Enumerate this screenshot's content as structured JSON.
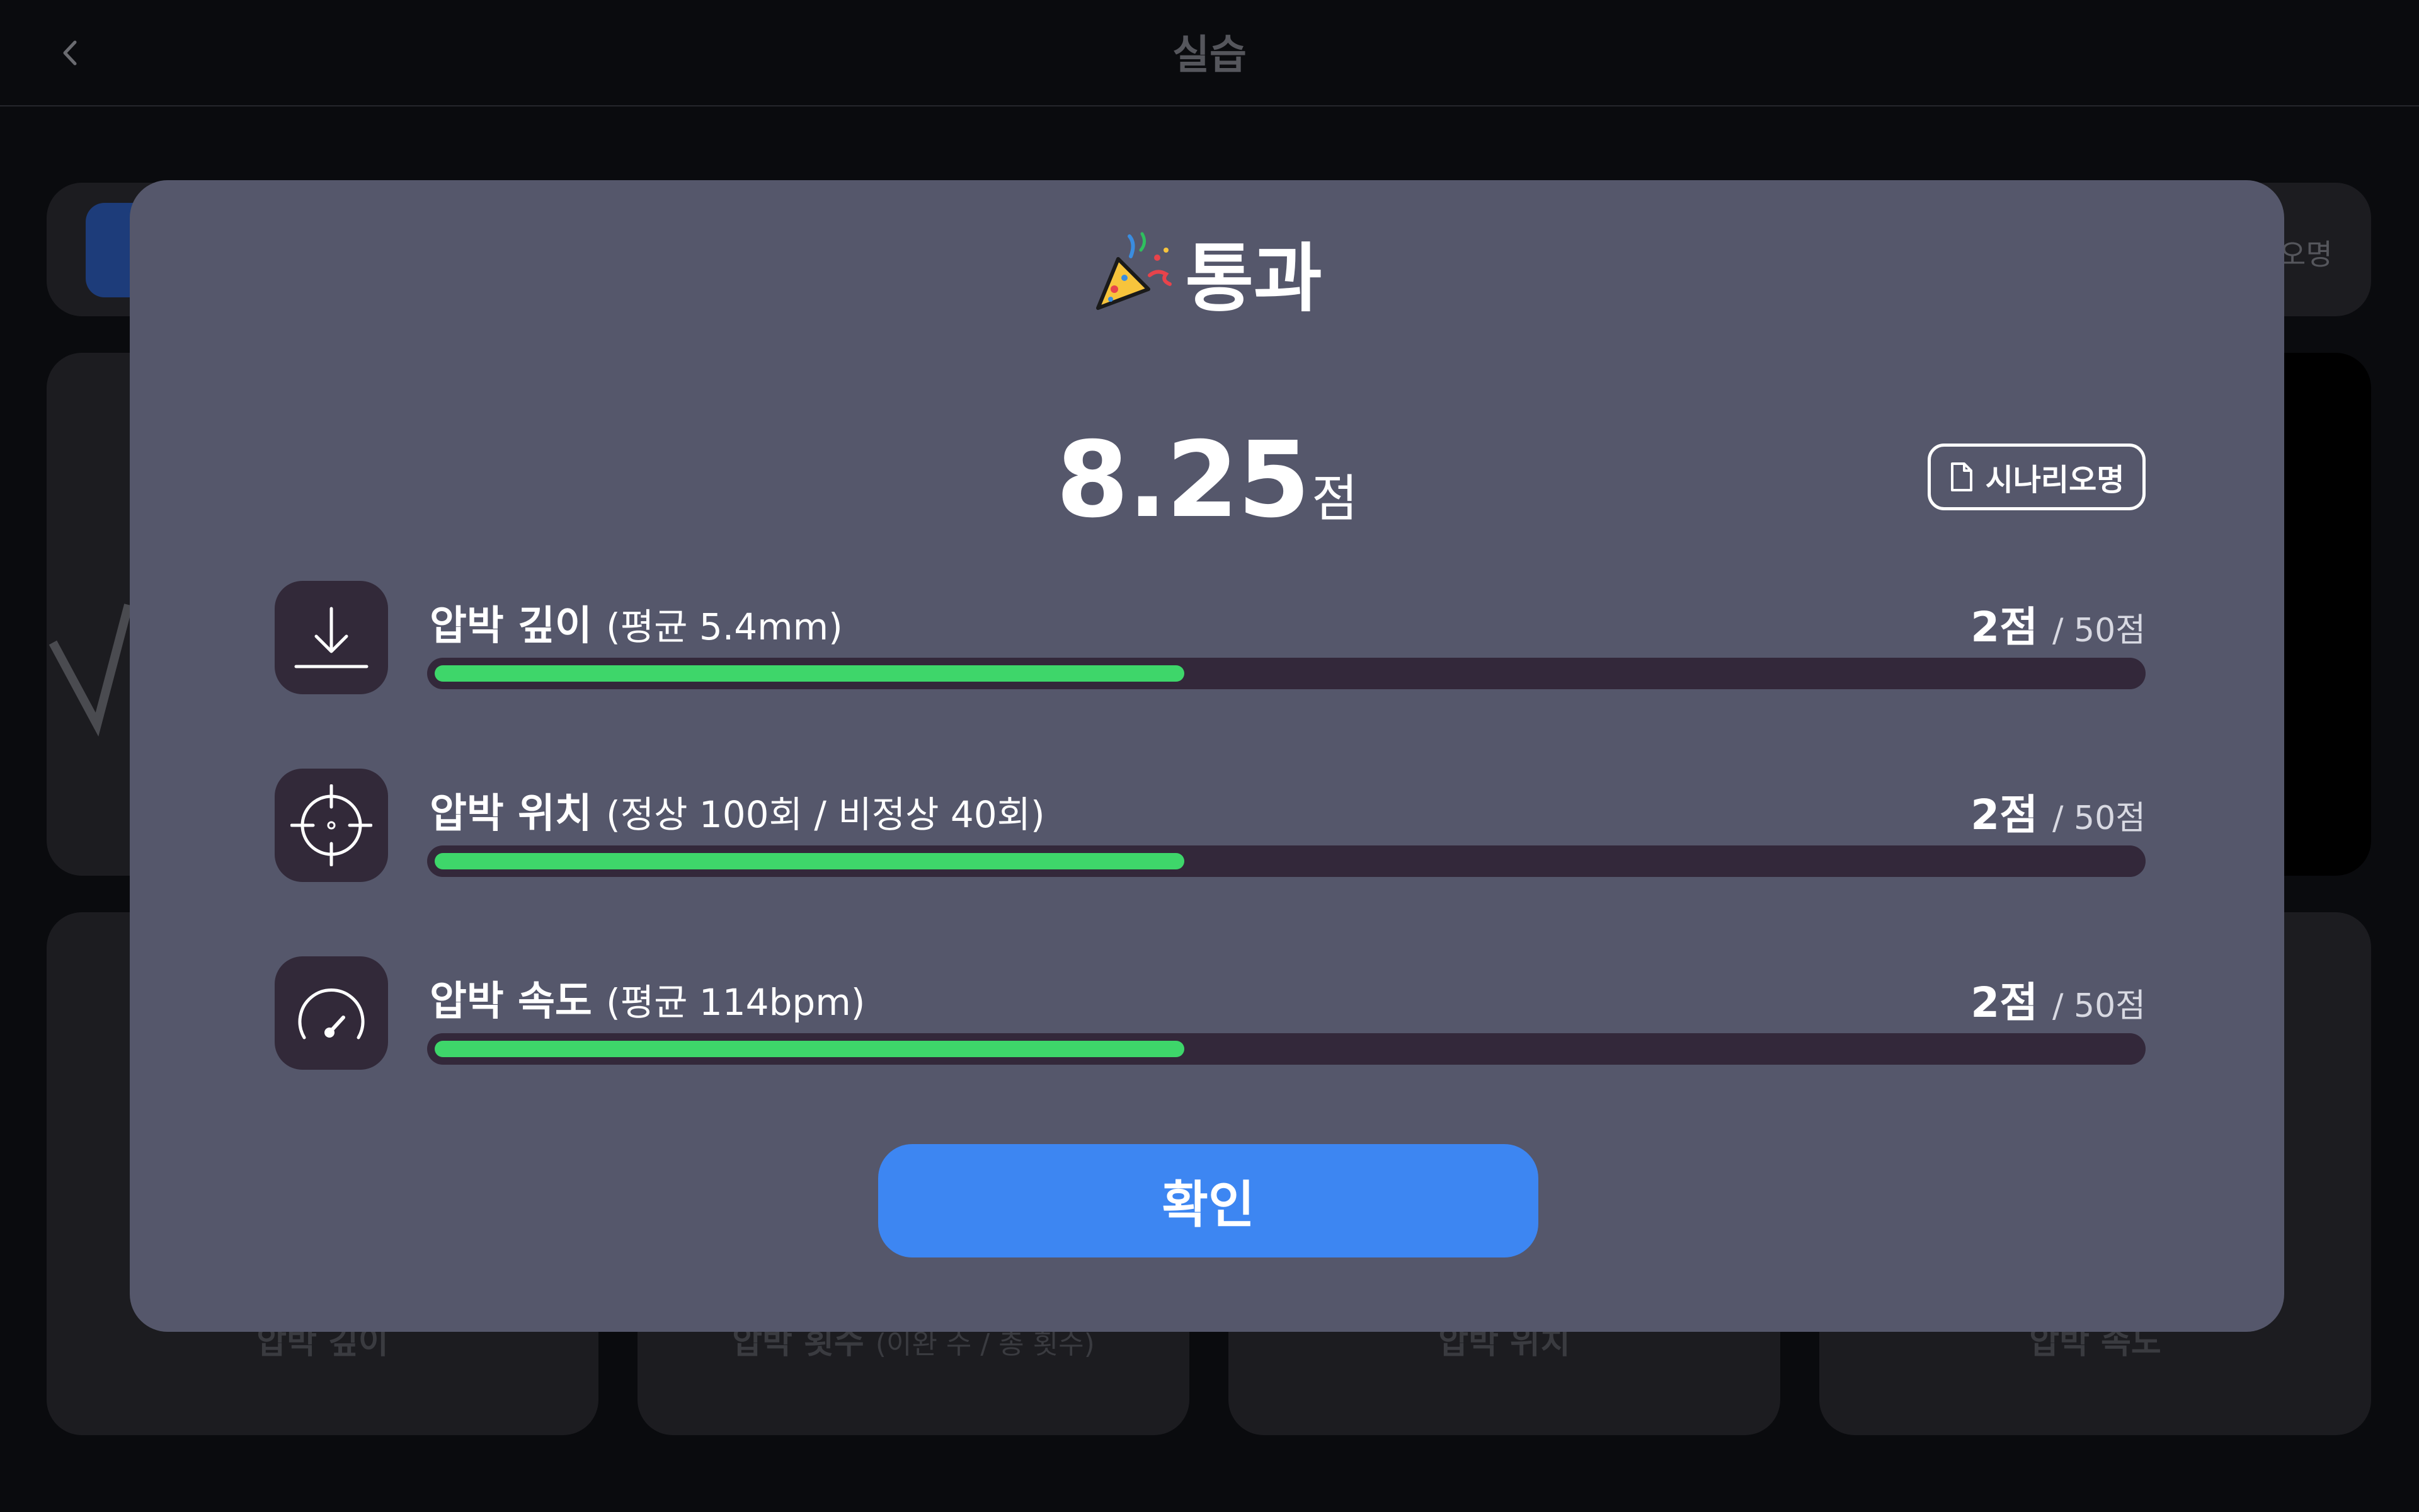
{
  "header": {
    "title": "실습",
    "back_icon": "chevron-left-icon"
  },
  "background": {
    "tab_right_label": "오명",
    "tiles": [
      {
        "label": "압박 깊이",
        "sub": ""
      },
      {
        "label": "압박 횟수",
        "sub": "(이완 수 / 총 횟수)"
      },
      {
        "label": "압박 위치",
        "sub": ""
      },
      {
        "label": "압박 속도",
        "sub": ""
      }
    ]
  },
  "modal": {
    "title": "통과",
    "title_icon": "party-popper-icon",
    "score_value": "8.25",
    "score_unit": "점",
    "scenario_button_label": "시나리오명",
    "scenario_icon": "document-icon",
    "metrics": [
      {
        "icon": "download-arrow-icon",
        "label": "압박 깊이",
        "detail": "(평균 5.4mm)",
        "score": "2점",
        "max": "/ 50점",
        "progress": 0.44
      },
      {
        "icon": "crosshair-icon",
        "label": "압박 위치",
        "detail": "(정상 100회 / 비정상 40회)",
        "score": "2점",
        "max": "/ 50점",
        "progress": 0.44
      },
      {
        "icon": "speedometer-icon",
        "label": "압박 속도",
        "detail": "(평균 114bpm)",
        "score": "2점",
        "max": "/ 50점",
        "progress": 0.44
      }
    ],
    "confirm_label": "확인"
  },
  "colors": {
    "modal_bg": "#55576b",
    "progress_fill": "#3ed66a",
    "progress_track": "#33283a",
    "confirm_button": "#3d86f2"
  }
}
